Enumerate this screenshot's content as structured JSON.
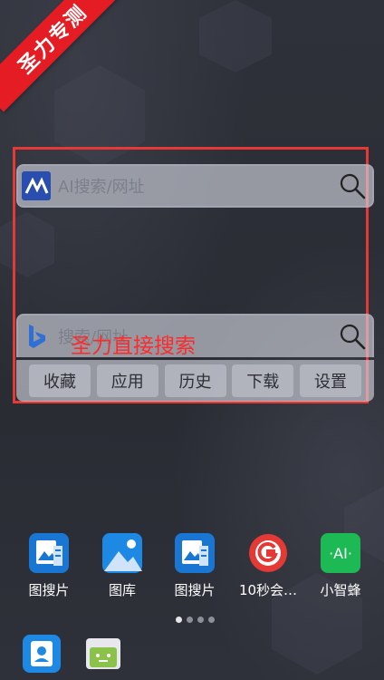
{
  "watermark": {
    "ribbon_text": "圣力专测",
    "annotation_text": "圣力直接搜索"
  },
  "search_widget_ai": {
    "placeholder": "AI搜索/网址",
    "logo": "ai-logo-icon",
    "action_icon": "search-icon"
  },
  "search_widget_bing": {
    "placeholder": "搜索/网址",
    "logo": "bing-logo-icon",
    "action_icon": "search-icon",
    "tabs": [
      "收藏",
      "应用",
      "历史",
      "下载",
      "设置"
    ]
  },
  "apps": [
    {
      "label": "图搜片",
      "icon": "image-search-icon"
    },
    {
      "label": "图库",
      "icon": "gallery-icon"
    },
    {
      "label": "图搜片",
      "icon": "image-search-icon"
    },
    {
      "label": "10秒会…",
      "icon": "g-badge-icon"
    },
    {
      "label": "小智蜂",
      "icon": "ai-chat-icon"
    }
  ],
  "page_indicator": {
    "pages": 4,
    "active": 0
  },
  "dock": [
    {
      "icon": "contacts-icon"
    },
    {
      "icon": "messages-icon"
    }
  ],
  "colors": {
    "annotation_red": "#e53935",
    "ribbon_red": "#e51c23",
    "gallery_blue": "#1e88e5",
    "ai_green": "#1db954"
  }
}
